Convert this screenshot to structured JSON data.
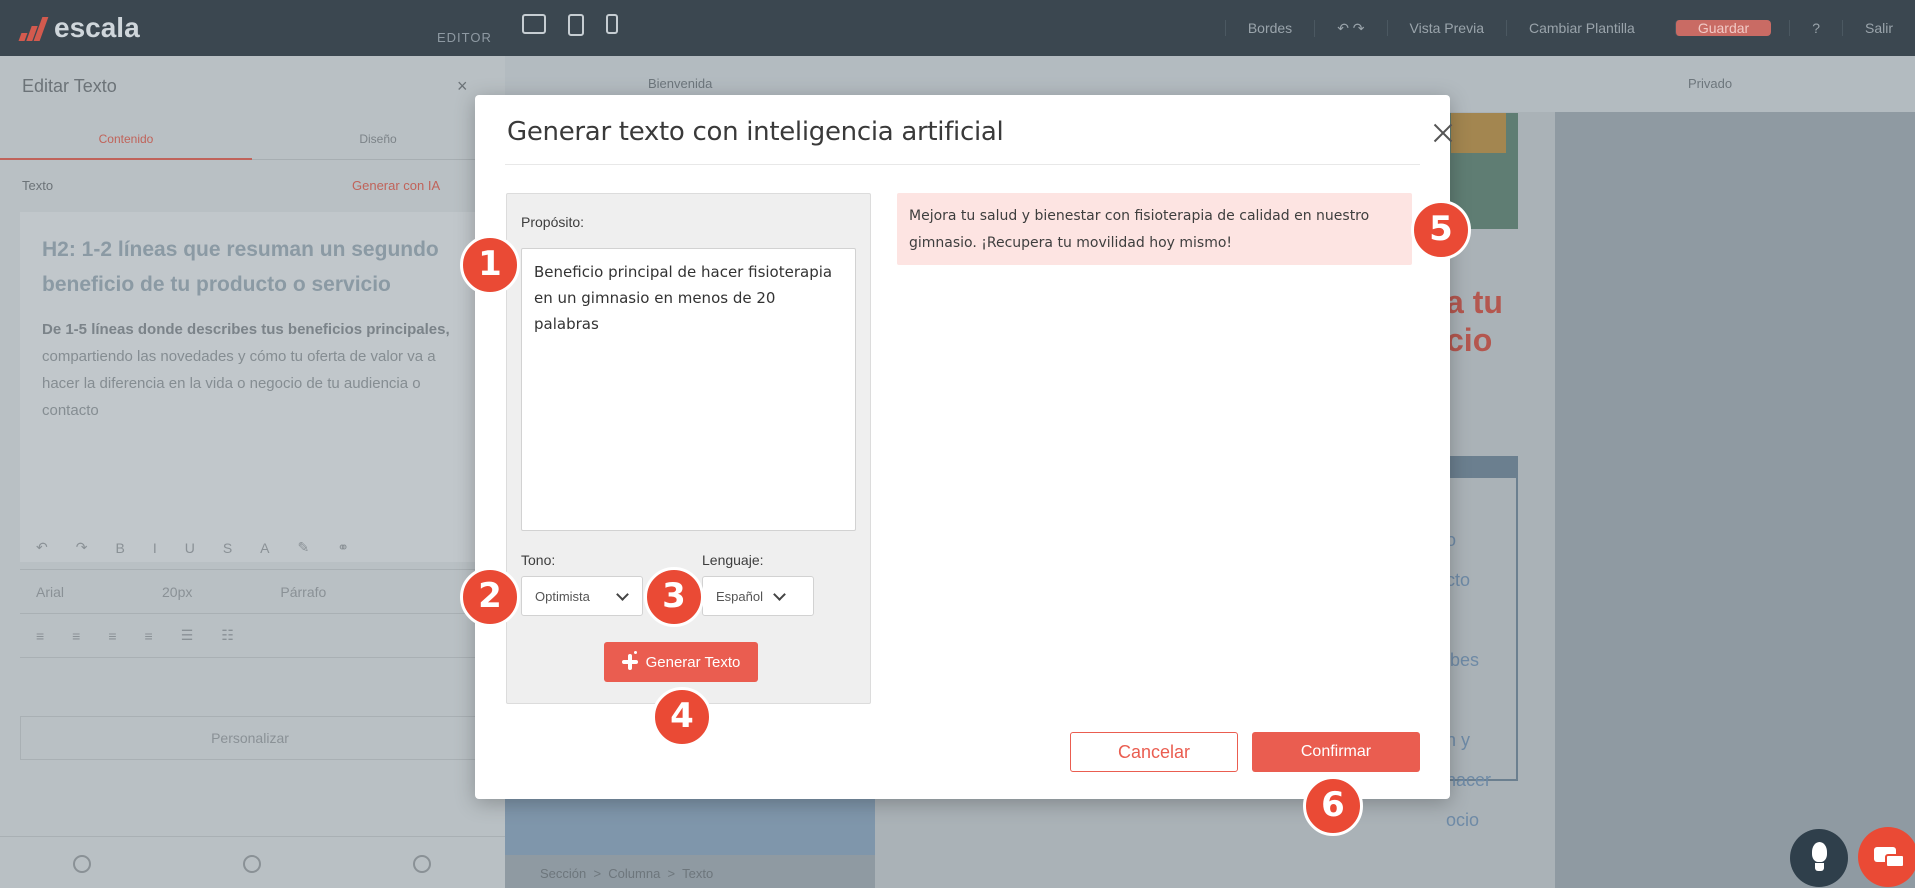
{
  "app": {
    "logo_text": "escala",
    "editor_tag": "EDITOR",
    "topnav": {
      "borders": "Bordes",
      "preview": "Vista Previa",
      "change_template": "Cambiar Plantilla",
      "save": "Guardar",
      "exit": "Salir"
    }
  },
  "left_panel": {
    "title": "Editar Texto",
    "close": "×",
    "tabs": [
      "Contenido",
      "Diseño"
    ],
    "text_label": "Texto",
    "generate_link": "Generar con IA",
    "h2_text": "H2: 1-2 líneas que resuman un segundo beneficio de tu producto o servicio",
    "body_bold": "De 1-5 líneas donde describes tus beneficios principales,",
    "body_rest": " compartiendo las novedades y cómo tu oferta de valor va a hacer la diferencia en la vida o negocio de tu audiencia o contacto",
    "font_name": "Arial",
    "font_size": "20px",
    "paragraph": "Párrafo",
    "customize": "Personalizar"
  },
  "canvas": {
    "page_name": "Bienvenida",
    "visibility": "Privado",
    "breadcrumb": "Sección  >  Columna  >  Texto",
    "bg_red_line1": "a tu",
    "bg_red_line2": "cio",
    "bg_box_text": "o\ncto\n\nibes\n\nn y\nhacer\nocio"
  },
  "modal": {
    "title": "Generar texto con inteligencia artificial",
    "purpose_label": "Propósito:",
    "purpose_value": "Beneficio principal de hacer fisioterapia en un gimnasio en menos de 20 palabras",
    "tone_label": "Tono:",
    "tone_value": "Optimista",
    "language_label": "Lenguaje:",
    "language_value": "Español",
    "generate_button": "Generar Texto",
    "result_text": "Mejora tu salud y bienestar con fisioterapia de calidad en nuestro gimnasio. ¡Recupera tu movilidad hoy mismo!",
    "cancel_button": "Cancelar",
    "confirm_button": "Confirmar"
  },
  "markers": [
    "1",
    "2",
    "3",
    "4",
    "5",
    "6"
  ],
  "colors": {
    "accent": "#ea5d50",
    "marker": "#ea4a35",
    "result_bg": "#fde4e2",
    "topbar": "#3b4750"
  },
  "icons": {
    "modal_close": "close-icon",
    "generate": "sparkle-icon",
    "bulb": "lightbulb-icon",
    "chat": "chat-icon"
  }
}
